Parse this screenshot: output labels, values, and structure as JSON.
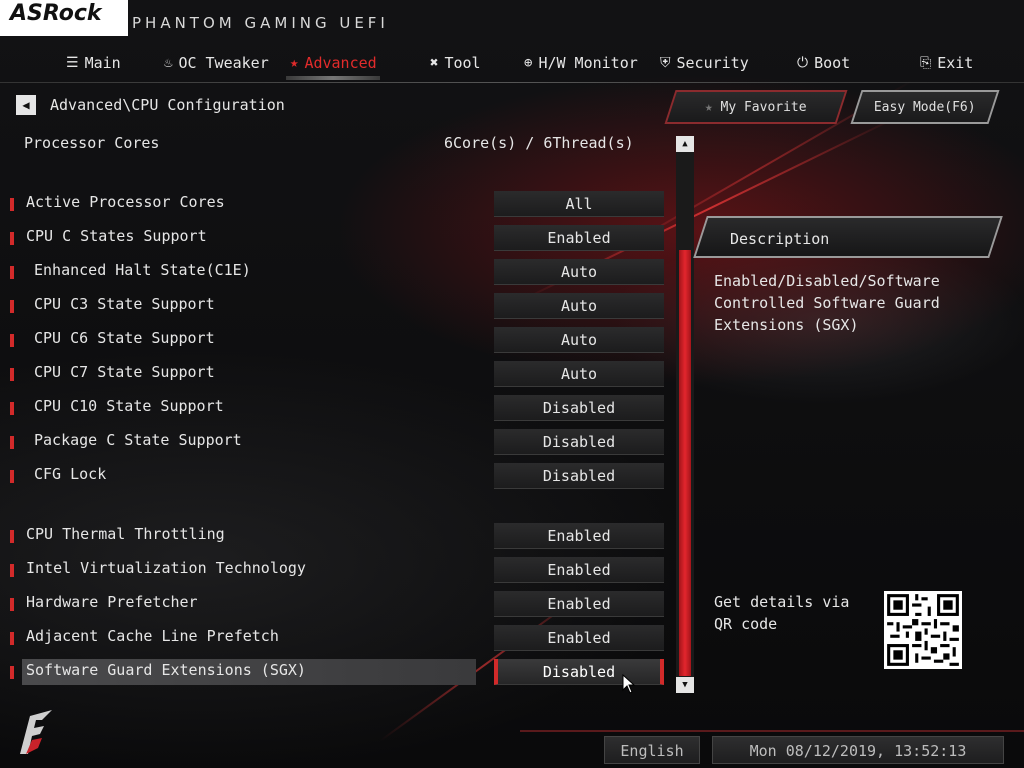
{
  "brand": {
    "logo_text": "ASRock",
    "subtitle": "PHANTOM GAMING UEFI"
  },
  "tabs": [
    {
      "label": "Main",
      "icon": "list-icon"
    },
    {
      "label": "OC Tweaker",
      "icon": "rocket-icon"
    },
    {
      "label": "Advanced",
      "icon": "star-icon",
      "active": true
    },
    {
      "label": "Tool",
      "icon": "tools-icon"
    },
    {
      "label": "H/W Monitor",
      "icon": "target-icon"
    },
    {
      "label": "Security",
      "icon": "shield-icon"
    },
    {
      "label": "Boot",
      "icon": "power-icon"
    },
    {
      "label": "Exit",
      "icon": "exit-door-icon"
    }
  ],
  "breadcrumb": "Advanced\\CPU Configuration",
  "buttons": {
    "my_favorite": "My Favorite",
    "easy_mode": "Easy Mode(F6)"
  },
  "info": {
    "label": "Processor Cores",
    "value": "6Core(s) / 6Thread(s)"
  },
  "settings": [
    {
      "label": "Active Processor Cores",
      "value": "All"
    },
    {
      "label": "CPU C States Support",
      "value": "Enabled"
    },
    {
      "label": "Enhanced Halt State(C1E)",
      "value": "Auto"
    },
    {
      "label": "CPU C3 State Support",
      "value": "Auto"
    },
    {
      "label": "CPU C6 State Support",
      "value": "Auto"
    },
    {
      "label": "CPU C7 State Support",
      "value": "Auto"
    },
    {
      "label": "CPU C10 State Support",
      "value": "Disabled"
    },
    {
      "label": "Package C State Support",
      "value": "Disabled"
    },
    {
      "label": "CFG Lock",
      "value": "Disabled"
    },
    {
      "label": "CPU Thermal Throttling",
      "value": "Enabled"
    },
    {
      "label": "Intel Virtualization Technology",
      "value": "Enabled"
    },
    {
      "label": "Hardware Prefetcher",
      "value": "Enabled"
    },
    {
      "label": "Adjacent Cache Line Prefetch",
      "value": "Enabled"
    },
    {
      "label": "Software Guard Extensions (SGX)",
      "value": "Disabled"
    }
  ],
  "description": {
    "title": "Description",
    "text": "Enabled/Disabled/Software Controlled Software Guard Extensions (SGX)"
  },
  "qr": {
    "label": "Get details via QR code"
  },
  "footer": {
    "language": "English",
    "datetime": "Mon 08/12/2019, 13:52:13"
  },
  "colors": {
    "accent": "#e22b2b",
    "scrollbar": "#d8232a",
    "text": "#e6e6e6"
  }
}
